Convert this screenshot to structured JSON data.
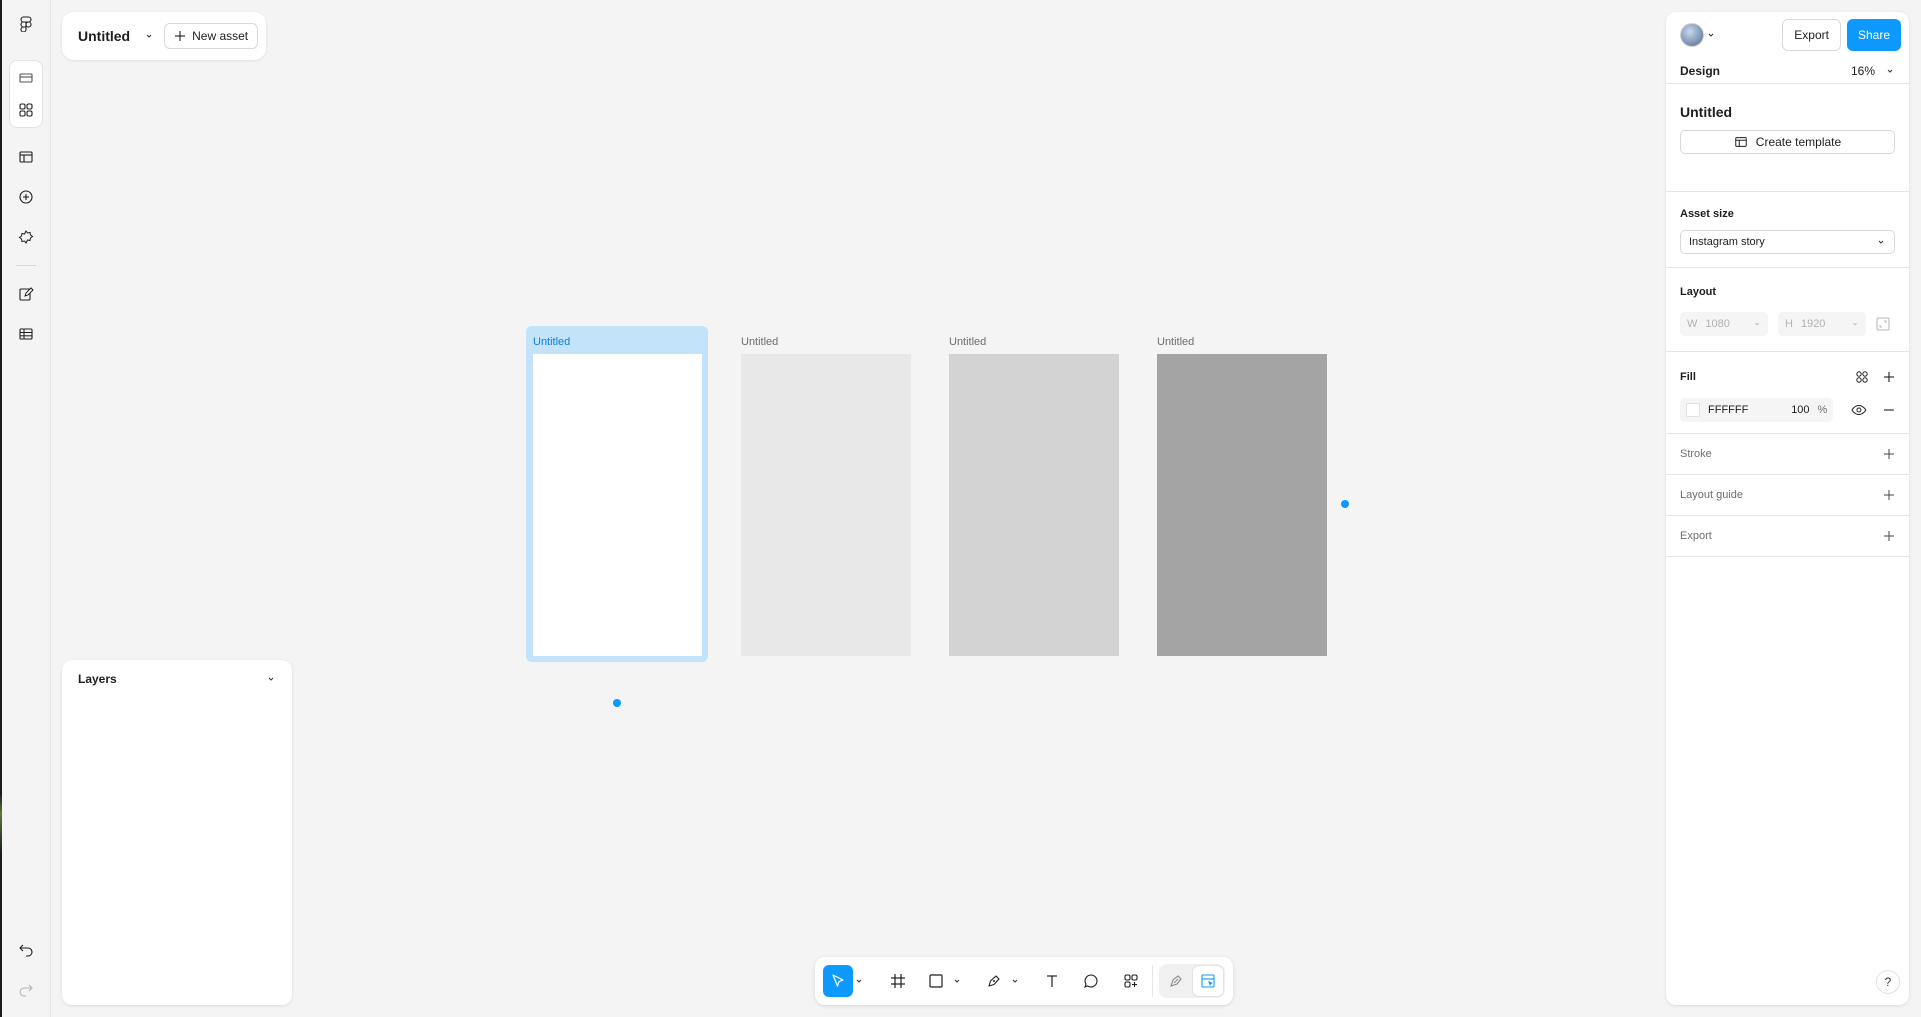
{
  "title_bar": {
    "title": "Untitled",
    "new_asset_label": "New asset"
  },
  "layers_panel": {
    "title": "Layers"
  },
  "canvas": {
    "frames": [
      {
        "label": "Untitled",
        "fill": "#FFFFFF",
        "selected": true
      },
      {
        "label": "Untitled",
        "fill": "#E8E8E8",
        "selected": false
      },
      {
        "label": "Untitled",
        "fill": "#D3D3D3",
        "selected": false
      },
      {
        "label": "Untitled",
        "fill": "#A4A4A4",
        "selected": false
      }
    ],
    "selection_color": "#0D99FF"
  },
  "right_panel": {
    "export_label": "Export",
    "share_label": "Share",
    "tab_label": "Design",
    "zoom": "16%",
    "asset_title": "Untitled",
    "create_template_label": "Create template",
    "asset_size": {
      "title": "Asset size",
      "value": "Instagram story"
    },
    "layout": {
      "title": "Layout",
      "w_label": "W",
      "w_value": "1080",
      "h_label": "H",
      "h_value": "1920"
    },
    "fill": {
      "title": "Fill",
      "hex": "FFFFFF",
      "opacity": "100",
      "unit": "%"
    },
    "stroke_title": "Stroke",
    "layout_guide_title": "Layout guide",
    "export_section_title": "Export",
    "help_label": "?"
  },
  "colors": {
    "accent": "#0D99FF",
    "selection_bg": "#C2E3FA"
  }
}
